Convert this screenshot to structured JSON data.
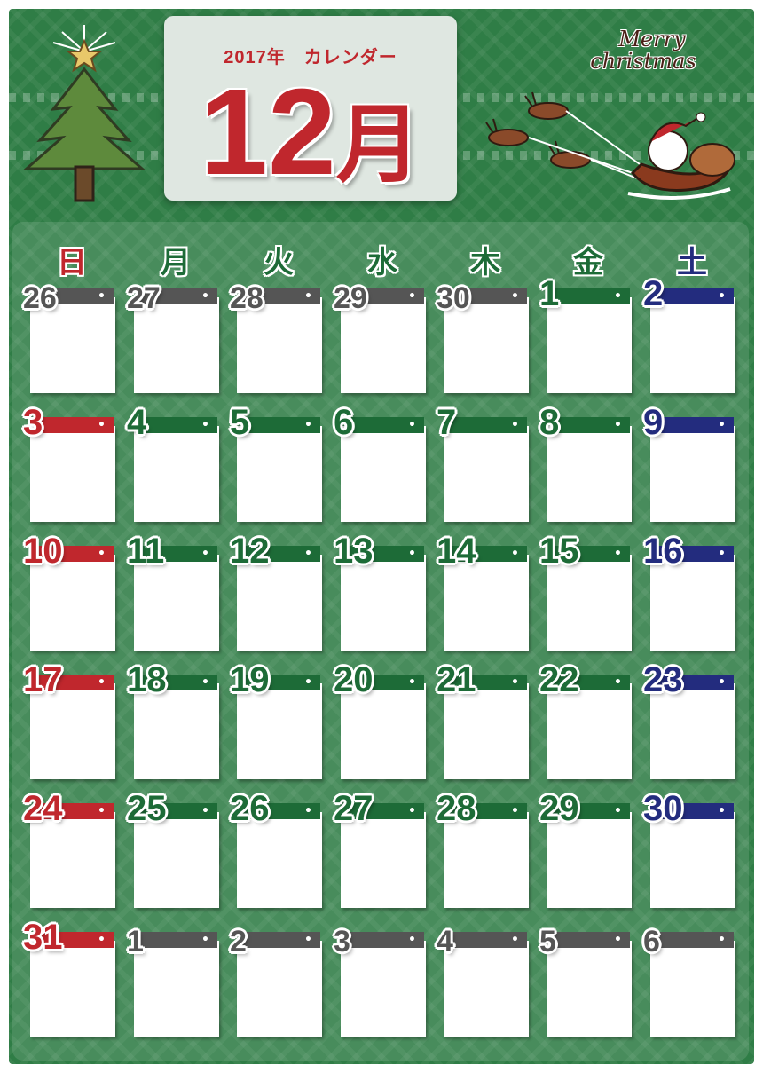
{
  "header": {
    "subtitle": "2017年　カレンダー",
    "month_number": "12",
    "month_unit": "月",
    "greeting_line1": "Merry",
    "greeting_line2": "christmas"
  },
  "icons": {
    "left": "christmas-tree-icon",
    "right": "santa-sleigh-reindeer-icon"
  },
  "colors": {
    "background": "#2f7d46",
    "sunday": "#c0272d",
    "weekday": "#1d6b37",
    "saturday": "#232c7e",
    "other_month": "#555555",
    "title": "#c0272d"
  },
  "weekdays": [
    "日",
    "月",
    "火",
    "水",
    "木",
    "金",
    "土"
  ],
  "weeks": [
    [
      {
        "d": "26",
        "t": "other"
      },
      {
        "d": "27",
        "t": "other"
      },
      {
        "d": "28",
        "t": "other"
      },
      {
        "d": "29",
        "t": "other"
      },
      {
        "d": "30",
        "t": "other"
      },
      {
        "d": "1",
        "t": "weekday"
      },
      {
        "d": "2",
        "t": "sat"
      }
    ],
    [
      {
        "d": "3",
        "t": "sun"
      },
      {
        "d": "4",
        "t": "weekday"
      },
      {
        "d": "5",
        "t": "weekday"
      },
      {
        "d": "6",
        "t": "weekday"
      },
      {
        "d": "7",
        "t": "weekday"
      },
      {
        "d": "8",
        "t": "weekday"
      },
      {
        "d": "9",
        "t": "sat"
      }
    ],
    [
      {
        "d": "10",
        "t": "sun"
      },
      {
        "d": "11",
        "t": "weekday"
      },
      {
        "d": "12",
        "t": "weekday"
      },
      {
        "d": "13",
        "t": "weekday"
      },
      {
        "d": "14",
        "t": "weekday"
      },
      {
        "d": "15",
        "t": "weekday"
      },
      {
        "d": "16",
        "t": "sat"
      }
    ],
    [
      {
        "d": "17",
        "t": "sun"
      },
      {
        "d": "18",
        "t": "weekday"
      },
      {
        "d": "19",
        "t": "weekday"
      },
      {
        "d": "20",
        "t": "weekday"
      },
      {
        "d": "21",
        "t": "weekday"
      },
      {
        "d": "22",
        "t": "weekday"
      },
      {
        "d": "23",
        "t": "sat"
      }
    ],
    [
      {
        "d": "24",
        "t": "sun"
      },
      {
        "d": "25",
        "t": "weekday"
      },
      {
        "d": "26",
        "t": "weekday"
      },
      {
        "d": "27",
        "t": "weekday"
      },
      {
        "d": "28",
        "t": "weekday"
      },
      {
        "d": "29",
        "t": "weekday"
      },
      {
        "d": "30",
        "t": "sat"
      }
    ],
    [
      {
        "d": "31",
        "t": "sun"
      },
      {
        "d": "1",
        "t": "other"
      },
      {
        "d": "2",
        "t": "other"
      },
      {
        "d": "3",
        "t": "other"
      },
      {
        "d": "4",
        "t": "other"
      },
      {
        "d": "5",
        "t": "other"
      },
      {
        "d": "6",
        "t": "other"
      }
    ]
  ]
}
